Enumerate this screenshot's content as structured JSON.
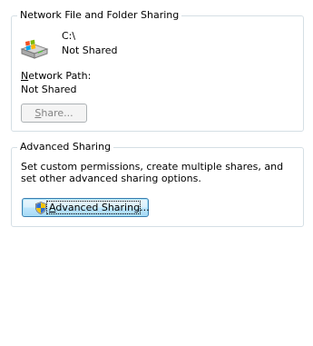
{
  "sharing": {
    "title": "Network File and Folder Sharing",
    "drive": {
      "name": "C:\\",
      "status": "Not Shared",
      "icon": "network-drive-icon"
    },
    "network_path_label": "Network Path:",
    "network_path_value": "Not Shared",
    "share_button": "Share...",
    "share_button_enabled": false
  },
  "advanced": {
    "title": "Advanced Sharing",
    "description": "Set custom permissions, create multiple shares, and set other advanced sharing options.",
    "button": "Advanced Sharing...",
    "button_icon": "uac-shield-icon"
  },
  "colors": {
    "group_border": "#d5dfe5",
    "disabled_text": "#838383",
    "focus_button_border": "#3c7fb1"
  }
}
